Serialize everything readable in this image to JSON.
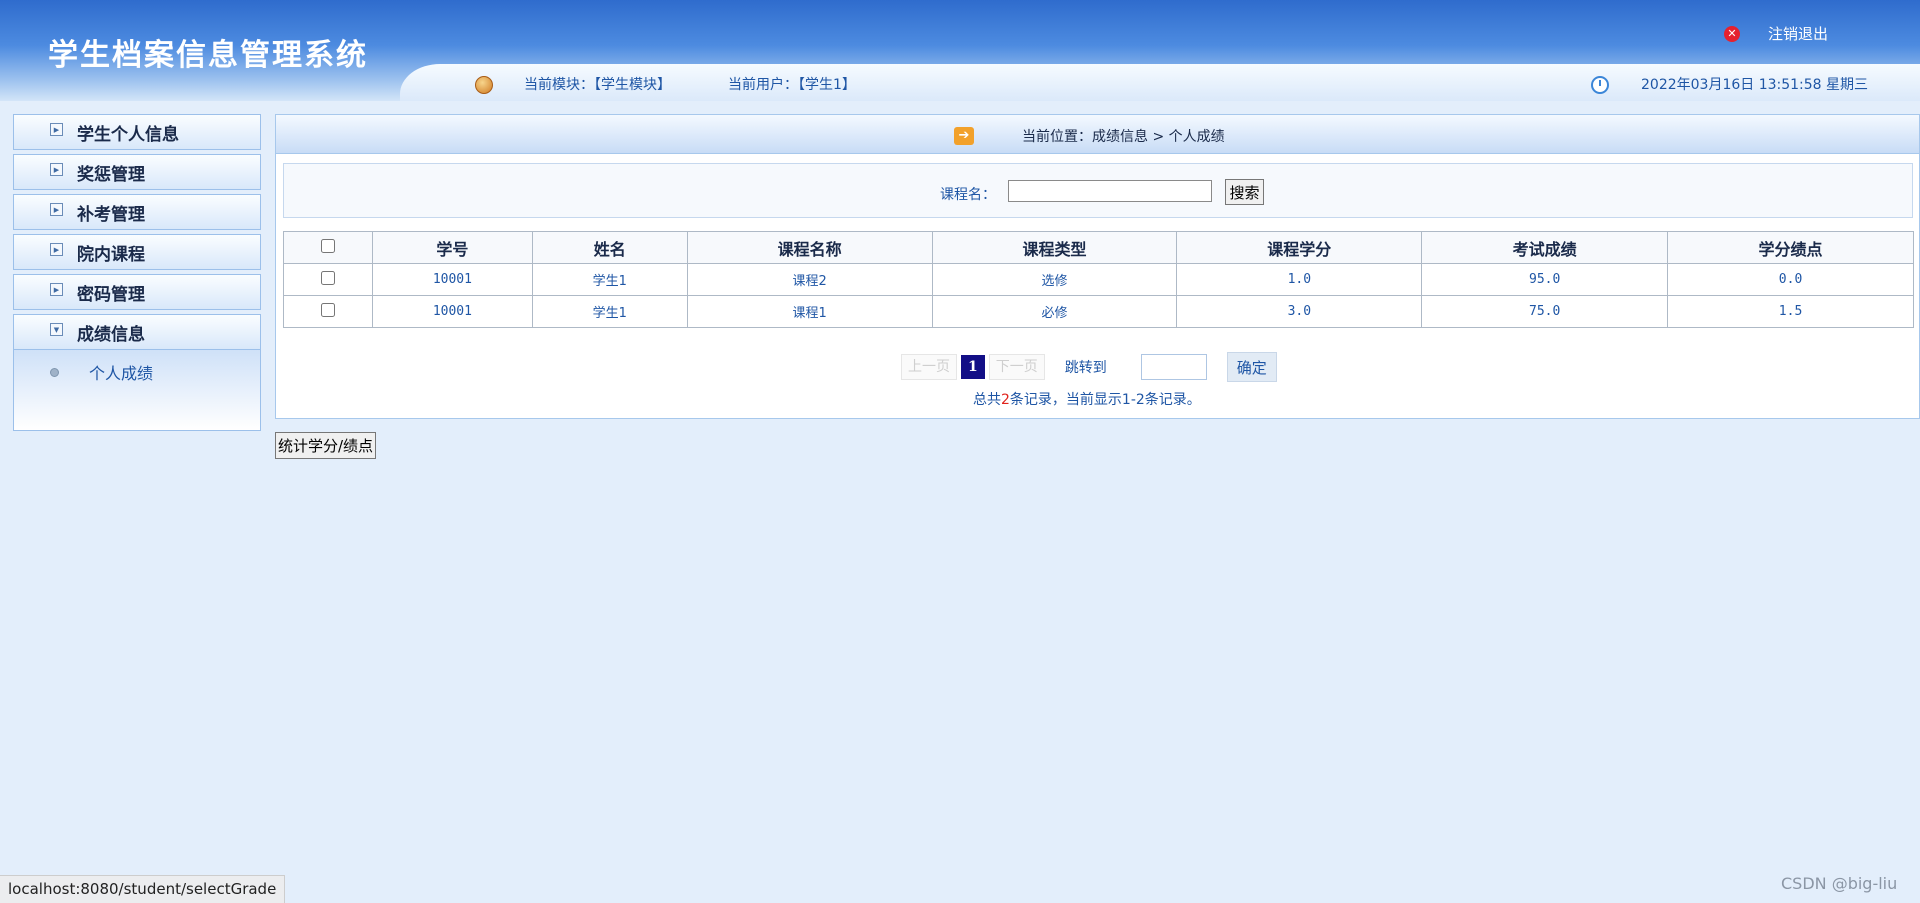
{
  "header": {
    "title": "学生档案信息管理系统",
    "module": "当前模块：【学生模块】",
    "user": "当前用户：【学生1】",
    "datetime": "2022年03月16日 13:51:58 星期三",
    "logout": "注销退出"
  },
  "sidebar": {
    "items": [
      {
        "label": "学生个人信息"
      },
      {
        "label": "奖惩管理"
      },
      {
        "label": "补考管理"
      },
      {
        "label": "院内课程"
      },
      {
        "label": "密码管理"
      },
      {
        "label": "成绩信息"
      }
    ],
    "sub_item": "个人成绩"
  },
  "breadcrumb": "当前位置：成绩信息 > 个人成绩",
  "search": {
    "label": "课程名：",
    "value": "",
    "button": "搜索"
  },
  "table": {
    "headers": [
      "学号",
      "姓名",
      "课程名称",
      "课程类型",
      "课程学分",
      "考试成绩",
      "学分绩点"
    ],
    "rows": [
      [
        "10001",
        "学生1",
        "课程2",
        "选修",
        "1.0",
        "95.0",
        "0.0"
      ],
      [
        "10001",
        "学生1",
        "课程1",
        "必修",
        "3.0",
        "75.0",
        "1.5"
      ]
    ]
  },
  "pager": {
    "prev": "上一页",
    "current": "1",
    "next": "下一页",
    "jump_label": "跳转到",
    "confirm": "确定",
    "summary_pre": "总共",
    "summary_count": "2",
    "summary_post": "条记录，当前显示1-2条记录。"
  },
  "stat_button": "统计学分/绩点",
  "statusbar": "localhost:8080/student/selectGrade",
  "watermark": "CSDN @big-liu",
  "colors": {
    "header_blue": "#2f6ccd",
    "link_blue": "#1f56a5",
    "pager_current": "#120e86",
    "count_red": "#e0231c"
  }
}
